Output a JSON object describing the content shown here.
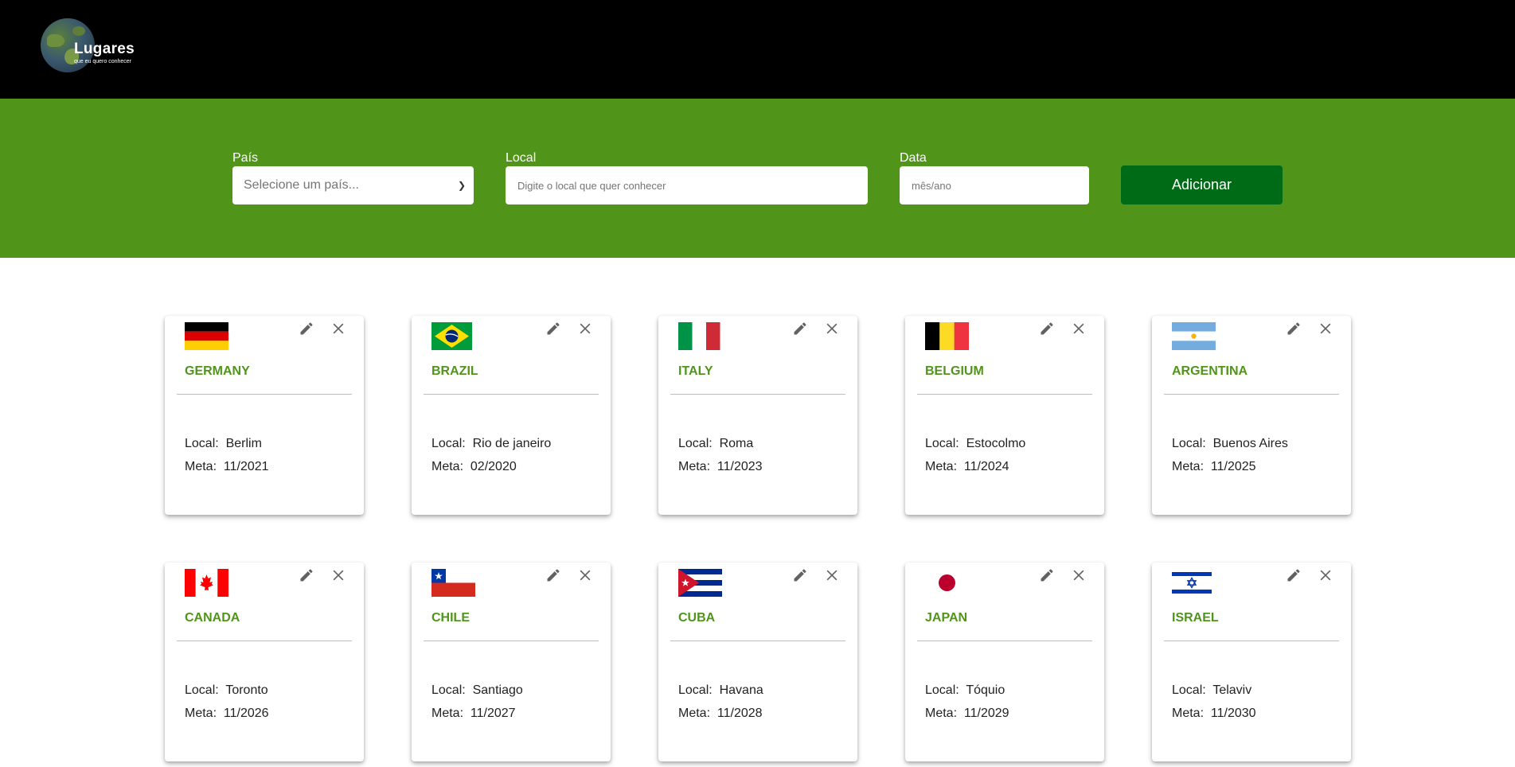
{
  "header": {
    "logo_title": "Lugares",
    "logo_subtitle": "que eu quero conhecer",
    "icon": "globe-icon"
  },
  "form": {
    "country_label": "País",
    "country_value": "Selecione um país...",
    "local_label": "Local",
    "local_placeholder": "Digite o local que quer conhecer",
    "date_label": "Data",
    "date_placeholder": "mês/ano",
    "add_button": "Adicionar"
  },
  "labels": {
    "local": "Local:",
    "meta": "Meta:"
  },
  "colors": {
    "header_bg": "#000000",
    "form_bg": "#50951a",
    "button_bg": "#006b17",
    "country_text": "#50951a"
  },
  "cards": [
    {
      "country": "GERMANY",
      "local": "Berlim",
      "meta": "11/2021",
      "flag": "germany-flag"
    },
    {
      "country": "BRAZIL",
      "local": "Rio de janeiro",
      "meta": "02/2020",
      "flag": "brazil-flag"
    },
    {
      "country": "ITALY",
      "local": "Roma",
      "meta": "11/2023",
      "flag": "italy-flag"
    },
    {
      "country": "BELGIUM",
      "local": "Estocolmo",
      "meta": "11/2024",
      "flag": "belgium-flag"
    },
    {
      "country": "ARGENTINA",
      "local": "Buenos Aires",
      "meta": "11/2025",
      "flag": "argentina-flag"
    },
    {
      "country": "CANADA",
      "local": "Toronto",
      "meta": "11/2026",
      "flag": "canada-flag"
    },
    {
      "country": "CHILE",
      "local": "Santiago",
      "meta": "11/2027",
      "flag": "chile-flag"
    },
    {
      "country": "CUBA",
      "local": "Havana",
      "meta": "11/2028",
      "flag": "cuba-flag"
    },
    {
      "country": "JAPAN",
      "local": "Tóquio",
      "meta": "11/2029",
      "flag": "japan-flag"
    },
    {
      "country": "ISRAEL",
      "local": "Telaviv",
      "meta": "11/2030",
      "flag": "israel-flag"
    }
  ]
}
